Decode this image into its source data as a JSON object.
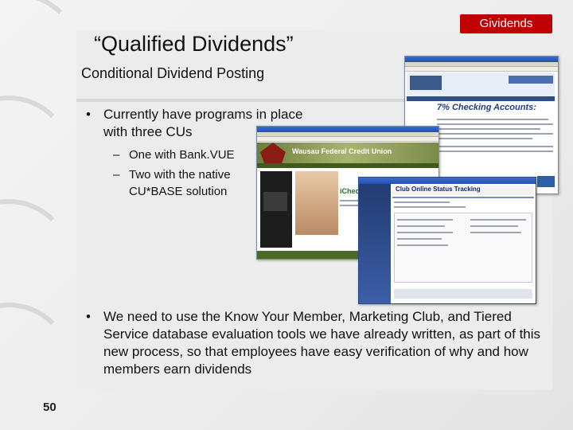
{
  "tag": "Gividends",
  "title": "“Qualified Dividends”",
  "subtitle": "Conditional Dividend Posting",
  "bullets": [
    {
      "text1": "Currently have programs in place",
      "text2": "with three CUs"
    },
    {
      "text": "We need to use the Know Your Member, Marketing Club, and Tiered Service database evaluation tools we have already written, as part of this new process, so that employees have easy verification of why and how members earn dividends"
    }
  ],
  "subbullets": [
    {
      "text": "One with Bank.VUE"
    },
    {
      "text1": "Two with the native",
      "text2": "CU*BASE solution"
    }
  ],
  "bullet_glyph": "•",
  "dash_glyph": "–",
  "screenshots": {
    "right": {
      "heading": "7% Checking Accounts:"
    },
    "middle": {
      "banner": "Wausau Federal Credit Union",
      "promo": "iChecking"
    },
    "front": {
      "heading": "Club Online Status Tracking"
    }
  },
  "page_number": "50",
  "colors": {
    "tag": "#c00000",
    "content": "#ececec"
  }
}
